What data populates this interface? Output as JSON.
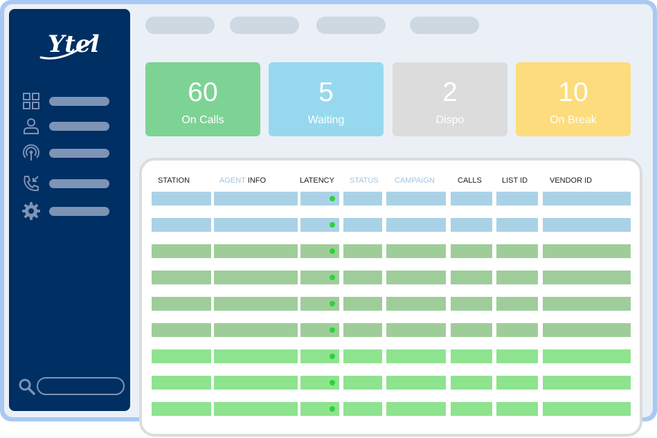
{
  "sidebar": {
    "logo_text": "Ytel",
    "nav_items": [
      {
        "icon": "grid-icon"
      },
      {
        "icon": "user-icon"
      },
      {
        "icon": "broadcast-icon"
      },
      {
        "icon": "incoming-call-icon"
      },
      {
        "icon": "gear-icon"
      }
    ],
    "search_placeholder": ""
  },
  "stats": [
    {
      "value": "60",
      "label": "On Calls",
      "color": "#7dd394"
    },
    {
      "value": "5",
      "label": "Waiting",
      "color": "#96d9ef"
    },
    {
      "value": "2",
      "label": "Dispo",
      "color": "#dcdcdc"
    },
    {
      "value": "10",
      "label": "On Break",
      "color": "#fcdc7c"
    }
  ],
  "table": {
    "headers": {
      "station": "STATION",
      "agent": "AGENT",
      "info": "INFO",
      "latency": "LATENCY",
      "status": "STATUS",
      "campaign": "CAMPAIGN",
      "calls": "CALLS",
      "list_id": "LIST ID",
      "vendor_id": "VENDOR ID"
    },
    "row_colors": [
      "#aad2e6",
      "#aad2e6",
      "#9fcd9a",
      "#9fcd9a",
      "#9fcd9a",
      "#9fcd9a",
      "#8ee38f",
      "#8ee38f",
      "#8ee38f"
    ],
    "latency_dot_color": "#2ed13a"
  },
  "colors": {
    "frame": "#a9c8f4",
    "background": "#eaf0f6",
    "sidebar": "#002f63",
    "placeholder_bar": "#7d94b5",
    "top_pill": "#cdd8e2"
  }
}
